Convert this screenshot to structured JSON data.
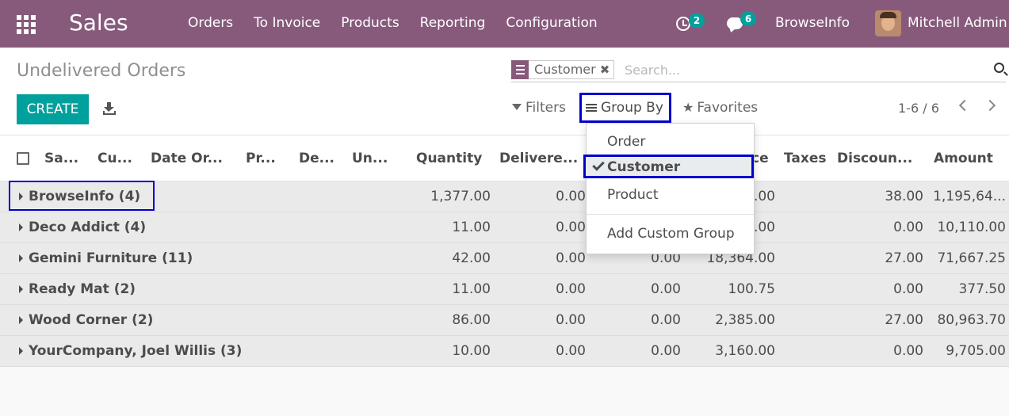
{
  "navbar": {
    "app_name": "Sales",
    "menu": [
      "Orders",
      "To Invoice",
      "Products",
      "Reporting",
      "Configuration"
    ],
    "activity_count": "2",
    "message_count": "6",
    "company": "BrowseInfo",
    "user": "Mitchell Admin",
    "color": "#875a7b"
  },
  "control_panel": {
    "title": "Undelivered Orders",
    "create_label": "CREATE",
    "search": {
      "facet": "Customer",
      "facet_remove": "✖",
      "placeholder": "Search..."
    },
    "filters_label": "Filters",
    "groupby_label": "Group By",
    "favorites_label": "Favorites",
    "pager": "1-6 / 6"
  },
  "groupby_dropdown": {
    "items": [
      "Order",
      "Customer",
      "Product"
    ],
    "selected": "Customer",
    "custom": "Add Custom Group"
  },
  "table": {
    "columns": [
      "Sa...",
      "Cu...",
      "Date Or...",
      "Pr...",
      "De...",
      "Un...",
      "Quantity",
      "Delivere...",
      "ce",
      "Taxes",
      "Discoun...",
      "Amount"
    ],
    "groups": [
      {
        "name": "BrowseInfo (4)",
        "quantity": "1,377.00",
        "delivered": "0.00",
        "invoiced": "",
        "subtotal": ".00",
        "discount": "38.00",
        "amount": "1,195,64..."
      },
      {
        "name": "Deco Addict (4)",
        "quantity": "11.00",
        "delivered": "0.00",
        "invoiced": "",
        "subtotal": ".00",
        "discount": "0.00",
        "amount": "10,110.00"
      },
      {
        "name": "Gemini Furniture (11)",
        "quantity": "42.00",
        "delivered": "0.00",
        "invoiced": "0.00",
        "subtotal": "18,364.00",
        "discount": "27.00",
        "amount": "71,667.25"
      },
      {
        "name": "Ready Mat (2)",
        "quantity": "11.00",
        "delivered": "0.00",
        "invoiced": "0.00",
        "subtotal": "100.75",
        "discount": "0.00",
        "amount": "377.50"
      },
      {
        "name": "Wood Corner (2)",
        "quantity": "86.00",
        "delivered": "0.00",
        "invoiced": "0.00",
        "subtotal": "2,385.00",
        "discount": "27.00",
        "amount": "80,963.70"
      },
      {
        "name": "YourCompany, Joel Willis (3)",
        "quantity": "10.00",
        "delivered": "0.00",
        "invoiced": "0.00",
        "subtotal": "3,160.00",
        "discount": "0.00",
        "amount": "9,705.00"
      }
    ]
  },
  "colors": {
    "accent": "#00a09d",
    "highlight_box": "#0000cc"
  }
}
